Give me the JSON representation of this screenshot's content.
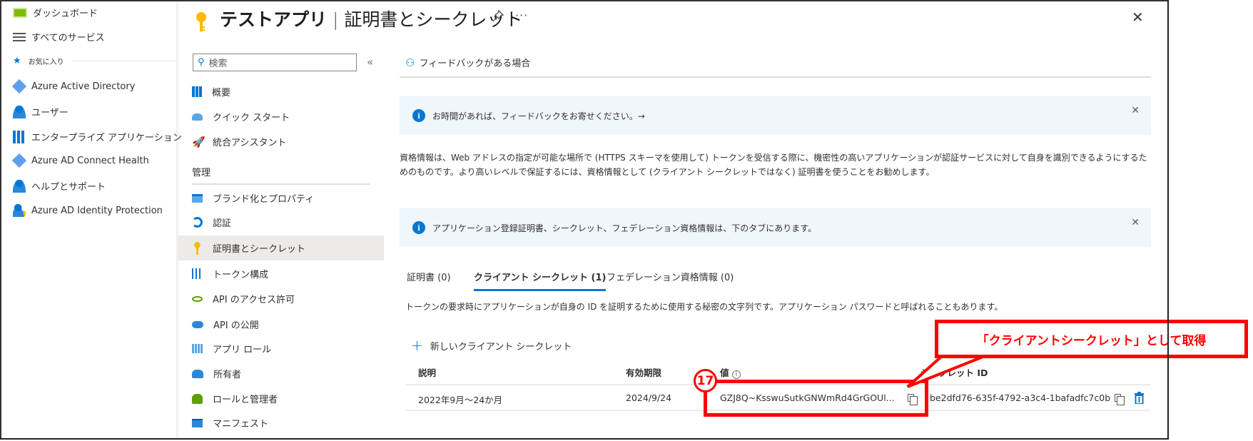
{
  "left_nav": {
    "items": [
      {
        "label": "ダッシュボード",
        "icon": "dashboard-icon"
      },
      {
        "label": "すべてのサービス",
        "icon": "list-icon"
      }
    ],
    "favorites_label": "お気に入り",
    "favorites": [
      {
        "label": "Azure Active Directory",
        "icon": "azure-ad-icon"
      },
      {
        "label": "ユーザー",
        "icon": "user-icon"
      },
      {
        "label": "エンタープライズ アプリケーション",
        "icon": "enterprise-apps-icon"
      },
      {
        "label": "Azure AD Connect Health",
        "icon": "connect-health-icon"
      },
      {
        "label": "ヘルプとサポート",
        "icon": "help-support-icon"
      },
      {
        "label": "Azure AD Identity Protection",
        "icon": "identity-protection-icon"
      }
    ]
  },
  "header": {
    "title_app": "テストアプリ",
    "title_sep": "|",
    "title_page": "証明書とシークレット"
  },
  "blade_menu": {
    "search_placeholder": "検索",
    "items_top": [
      {
        "label": "概要",
        "icon": "overview-icon"
      },
      {
        "label": "クイック スタート",
        "icon": "quickstart-icon"
      },
      {
        "label": "統合アシスタント",
        "icon": "rocket-icon"
      }
    ],
    "section_label": "管理",
    "items_manage": [
      {
        "label": "ブランド化とプロパティ",
        "icon": "branding-icon"
      },
      {
        "label": "認証",
        "icon": "authentication-icon"
      },
      {
        "label": "証明書とシークレット",
        "icon": "key-icon",
        "selected": true
      },
      {
        "label": "トークン構成",
        "icon": "token-config-icon"
      },
      {
        "label": "API のアクセス許可",
        "icon": "api-permissions-icon"
      },
      {
        "label": "API の公開",
        "icon": "expose-api-icon"
      },
      {
        "label": "アプリ ロール",
        "icon": "app-roles-icon"
      },
      {
        "label": "所有者",
        "icon": "owners-icon"
      },
      {
        "label": "ロールと管理者",
        "icon": "roles-admins-icon"
      },
      {
        "label": "マニフェスト",
        "icon": "manifest-icon"
      }
    ]
  },
  "content": {
    "feedback_label": "フィードバックがある場合",
    "info1": "お時間があれば、フィードバックをお寄せください。→",
    "description": "資格情報は、Web アドレスの指定が可能な場所で (HTTPS スキーマを使用して) トークンを受信する際に、機密性の高いアプリケーションが認証サービスに対して自身を識別できるようにするためのものです。より高いレベルで保証するには、資格情報として (クライアント シークレットではなく) 証明書を使うことをお勧めします。",
    "info2": "アプリケーション登録証明書、シークレット、フェデレーション資格情報は、下のタブにあります。",
    "tabs": [
      "証明書 (0)",
      "クライアント シークレット (1)",
      "フェデレーション資格情報 (0)"
    ],
    "active_tab": 1,
    "tab_description": "トークンの要求時にアプリケーションが自身の ID を証明するために使用する秘密の文字列です。アプリケーション パスワードと呼ばれることもあります。",
    "new_secret_label": "新しいクライアント シークレット",
    "table": {
      "headers": [
        "説明",
        "有効期限",
        "値",
        "シークレット ID"
      ],
      "rows": [
        [
          "2022年9月～24か月",
          "2024/9/24",
          "GZJ8Q~KsswuSutkGNWmRd4GrGOUl...",
          "be2dfd76-635f-4792-a3c4-1bafadfc7c0b"
        ]
      ]
    }
  },
  "annotation": {
    "step": "17",
    "callout": "「クライアントシークレット」として取得",
    "color": "#ff0000"
  },
  "colors": {
    "accent": "#0078d4",
    "info_bg": "#eff6fc",
    "selected_bg": "#edebe9"
  }
}
